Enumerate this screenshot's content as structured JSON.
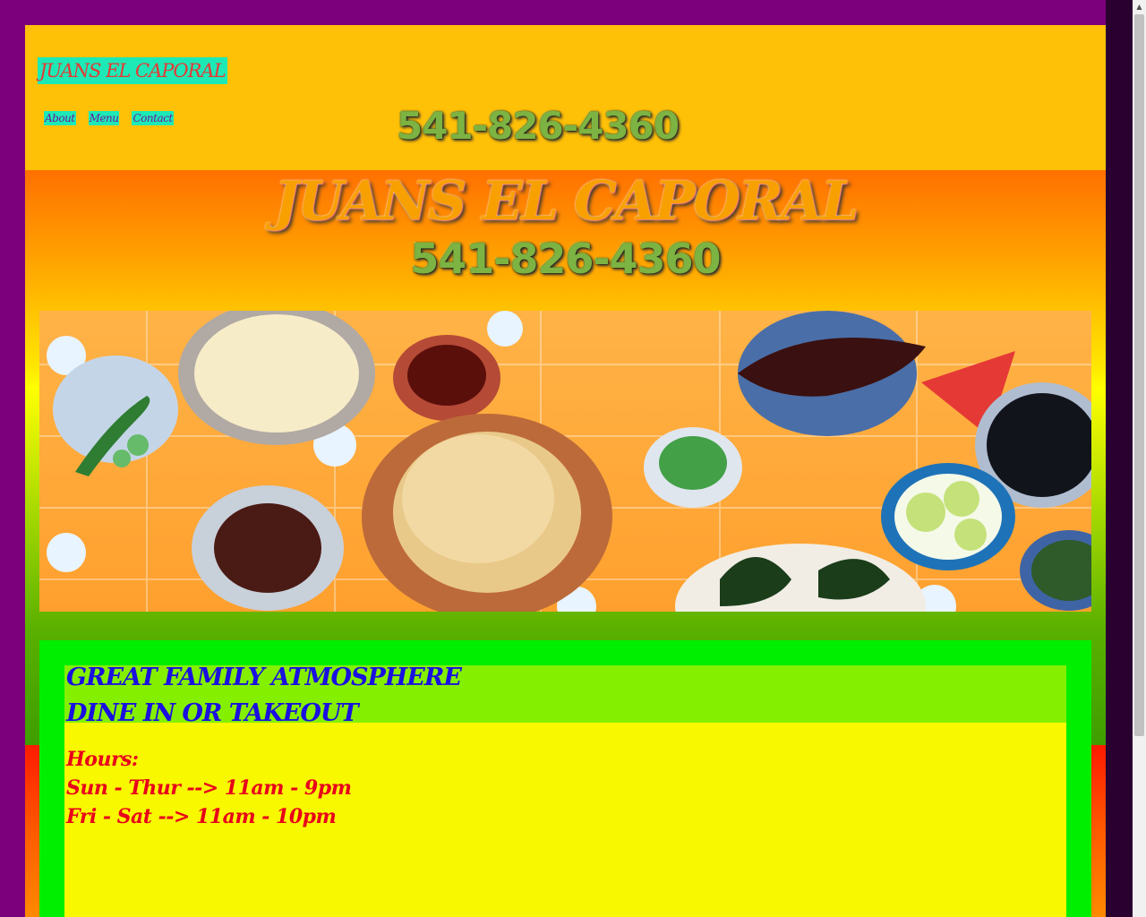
{
  "header": {
    "brand": "JUANS EL CAPORAL",
    "nav": [
      "About",
      "Menu",
      "Contact"
    ],
    "phone": "541-826-4360"
  },
  "hero": {
    "title": "JUANS EL CAPORAL",
    "phone": "541-826-4360",
    "banner_icon": "mexican-food-table-image"
  },
  "content": {
    "intro_line1": "GREAT FAMILY ATMOSPHERE",
    "intro_line2": "DINE IN OR TAKEOUT",
    "hours_heading": "Hours:",
    "hours_line1": "Sun - Thur --> 11am - 9pm",
    "hours_line2": "Fri - Sat --> 11am - 10pm"
  },
  "colors": {
    "page_bg": "#7c007c",
    "header_bg": "#ffc107",
    "brand_bg": "#1de9b6",
    "brand_text": "#e53935",
    "card_bg": "#00ee00",
    "intro_bg": "#84f000",
    "intro_text": "#1a10e0",
    "hours_bg": "#f8f800",
    "hours_text": "#e8001a"
  }
}
